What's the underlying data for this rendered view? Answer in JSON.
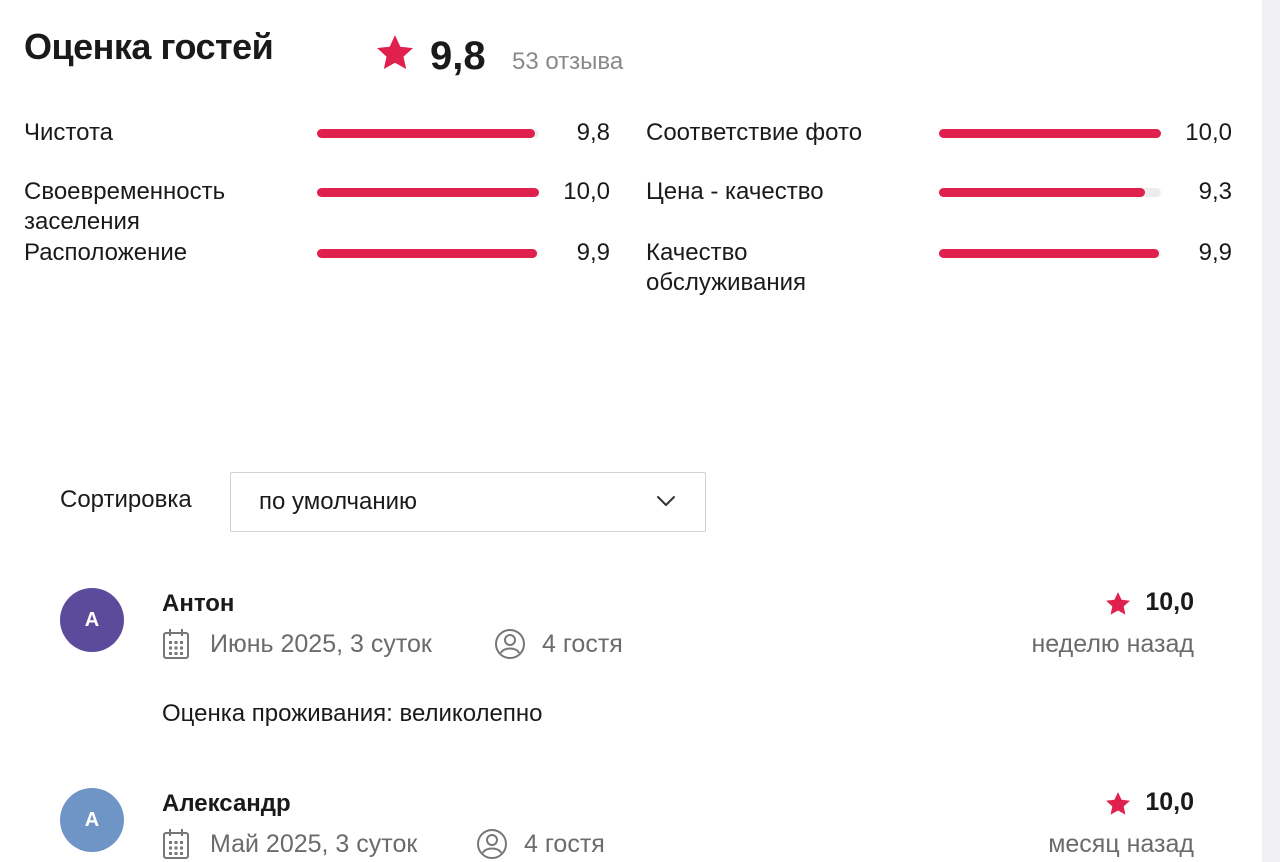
{
  "header": {
    "title": "Оценка гостей",
    "score": "9,8",
    "reviews_count": "53 отзыва"
  },
  "metrics": [
    {
      "label": "Чистота",
      "value": "9,8",
      "fill": 0.98
    },
    {
      "label": "Своевременность\nзаселения",
      "value": "10,0",
      "fill": 1.0
    },
    {
      "label": "Расположение",
      "value": "9,9",
      "fill": 0.99
    },
    {
      "label": "Соответствие фото",
      "value": "10,0",
      "fill": 1.0
    },
    {
      "label": "Цена - качество",
      "value": "9,3",
      "fill": 0.93
    },
    {
      "label": "Качество\nобслуживания",
      "value": "9,9",
      "fill": 0.99
    }
  ],
  "sort": {
    "label": "Сортировка",
    "selected": "по умолчанию"
  },
  "reviews": [
    {
      "avatar_letter": "А",
      "avatar_color": "#5b4b9a",
      "name": "Антон",
      "date": "Июнь 2025, 3 суток",
      "guests": "4 гостя",
      "score": "10,0",
      "ago": "неделю назад",
      "text": "Оценка проживания: великолепно"
    },
    {
      "avatar_letter": "А",
      "avatar_color": "#6f94c6",
      "name": "Александр",
      "date": "Май 2025, 3 суток",
      "guests": "4 гостя",
      "score": "10,0",
      "ago": "месяц назад",
      "text": ""
    }
  ],
  "colors": {
    "accent": "#e0204d",
    "muted_text": "#6b6b6b"
  },
  "icons": {
    "star": "star-icon",
    "calendar": "calendar-icon",
    "guest": "user-circle-icon",
    "chevron": "chevron-down-icon"
  }
}
